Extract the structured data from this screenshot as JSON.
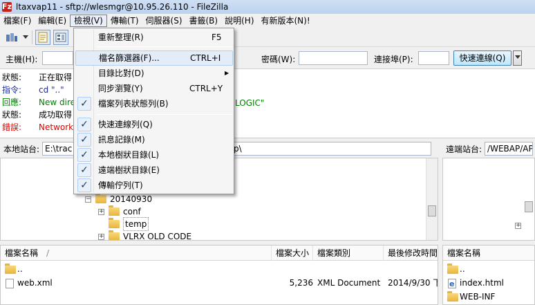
{
  "window": {
    "title": "ltaxvap11 - sftp://wlesmgr@10.95.26.110 - FileZilla",
    "app_icon": "Fz"
  },
  "menubar": [
    {
      "label": "檔案(F)"
    },
    {
      "label": "編輯(E)"
    },
    {
      "label": "檢視(V)"
    },
    {
      "label": "傳輸(T)"
    },
    {
      "label": "伺服器(S)"
    },
    {
      "label": "書籤(B)"
    },
    {
      "label": "說明(H)"
    },
    {
      "label": "有新版本(N)!"
    }
  ],
  "quickconnect": {
    "host_label": "主機(H):",
    "host_value": "",
    "password_label": "密碼(W):",
    "password_value": "",
    "port_label": "連接埠(P):",
    "port_value": "",
    "button_label": "快速連線(Q)"
  },
  "message_log": [
    {
      "type": "狀態:",
      "text": "正在取得",
      "kind": "status"
    },
    {
      "type": "指令:",
      "text": "cd \"..\"",
      "kind": "command"
    },
    {
      "type": "回應:",
      "text": "New dire",
      "kind": "response"
    },
    {
      "type": "狀態:",
      "text": "成功取得",
      "kind": "status"
    },
    {
      "type": "錯誤:",
      "text": "Network",
      "kind": "error"
    }
  ],
  "message_log_fragment": "LOGIC\"",
  "local_site": {
    "label": "本地站台:",
    "path_start": "E:\\trac",
    "path_end": "p\\"
  },
  "remote_site": {
    "label": "遠端站台:",
    "path": "/WEBAP/AP"
  },
  "local_tree": [
    {
      "label": "20140930",
      "expander": "−"
    },
    {
      "label": "conf",
      "expander": "+"
    },
    {
      "label": "temp",
      "expander": ""
    },
    {
      "label": "VLRX OLD CODE",
      "expander": "+"
    }
  ],
  "local_list": {
    "columns": [
      "檔案名稱",
      "檔案大小",
      "檔案類別",
      "最後修改時間"
    ],
    "sort_indicator": "/",
    "rows": [
      {
        "name": "..",
        "size": "",
        "type": "",
        "modified": "",
        "icon": "folder-icon"
      },
      {
        "name": "web.xml",
        "size": "5,236",
        "type": "XML Document",
        "modified": "2014/9/30 下",
        "icon": "xml-file-icon"
      }
    ]
  },
  "remote_list": {
    "columns": [
      "檔案名稱"
    ],
    "rows": [
      {
        "name": "..",
        "icon": "folder-icon"
      },
      {
        "name": "index.html",
        "icon": "html-file-icon"
      },
      {
        "name": "WEB-INF",
        "icon": "folder-icon"
      }
    ]
  },
  "view_menu": {
    "items": [
      {
        "label": "重新整理(R)",
        "shortcut": "F5",
        "checked": false
      },
      {
        "label": "檔名篩選器(F)...",
        "shortcut": "CTRL+I",
        "checked": false,
        "hover": true
      },
      {
        "label": "目錄比對(D)",
        "shortcut": "",
        "checked": false,
        "submenu": true
      },
      {
        "label": "同步瀏覽(Y)",
        "shortcut": "CTRL+Y",
        "checked": false
      },
      {
        "label": "檔案列表狀態列(B)",
        "shortcut": "",
        "checked": true
      },
      {
        "label": "快速連線列(Q)",
        "shortcut": "",
        "checked": true
      },
      {
        "label": "訊息記錄(M)",
        "shortcut": "",
        "checked": true
      },
      {
        "label": "本地樹狀目錄(L)",
        "shortcut": "",
        "checked": true
      },
      {
        "label": "遠端樹狀目錄(E)",
        "shortcut": "",
        "checked": true
      },
      {
        "label": "傳輸佇列(T)",
        "shortcut": "",
        "checked": true
      }
    ],
    "check_glyph": "✓",
    "submenu_glyph": "▶"
  },
  "colors": {
    "status": "#000000",
    "command": "#1a2aa8",
    "response": "#008000",
    "error": "#e00000",
    "menu_hover": "#e4ecf7",
    "check_bg": "#e8f1fb"
  }
}
